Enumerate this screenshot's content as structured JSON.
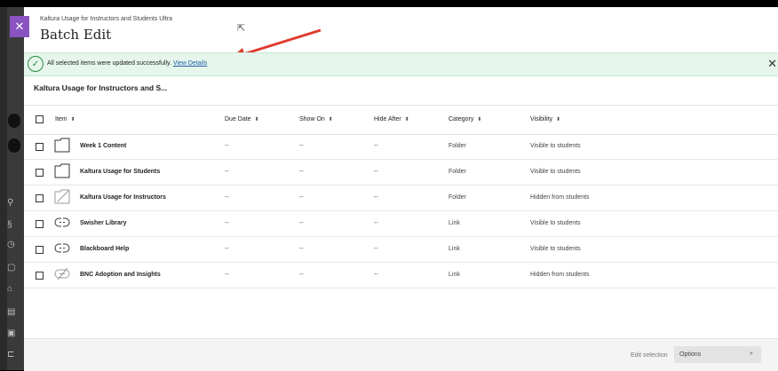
{
  "header": {
    "subtitle": "Kaltura Usage for Instructors and Students Ultra",
    "title": "Batch Edit"
  },
  "banner": {
    "message": "All selected items were updated successfully.",
    "link_label": "View Details"
  },
  "course_title": "Kaltura Usage for Instructors and S...",
  "table": {
    "columns": [
      "Item",
      "Due Date",
      "Show On",
      "Hide After",
      "Category",
      "Visibility"
    ],
    "rows": [
      {
        "name": "Week 1 Content",
        "icon": "folder-icon",
        "due": "--",
        "show_on": "--",
        "hide_after": "--",
        "category": "Folder",
        "visibility": "Visible to students"
      },
      {
        "name": "Kaltura Usage for Students",
        "icon": "folder-icon",
        "due": "--",
        "show_on": "--",
        "hide_after": "--",
        "category": "Folder",
        "visibility": "Visible to students"
      },
      {
        "name": "Kaltura Usage for Instructors",
        "icon": "hidden-folder-icon",
        "due": "--",
        "show_on": "--",
        "hide_after": "--",
        "category": "Folder",
        "visibility": "Hidden from students"
      },
      {
        "name": "Swisher Library",
        "icon": "link-icon",
        "due": "--",
        "show_on": "--",
        "hide_after": "--",
        "category": "Link",
        "visibility": "Visible to students"
      },
      {
        "name": "Blackboard Help",
        "icon": "link-icon",
        "due": "--",
        "show_on": "--",
        "hide_after": "--",
        "category": "Link",
        "visibility": "Visible to students"
      },
      {
        "name": "BNC Adoption and Insights",
        "icon": "hidden-link-icon",
        "due": "--",
        "show_on": "--",
        "hide_after": "--",
        "category": "Link",
        "visibility": "Hidden from students"
      }
    ]
  },
  "footer": {
    "edit_selection_label": "Edit selection",
    "options_value": "Options"
  },
  "colors": {
    "accent": "#8a53c2",
    "success": "#2d8a3e",
    "link": "#1d5fa8"
  }
}
